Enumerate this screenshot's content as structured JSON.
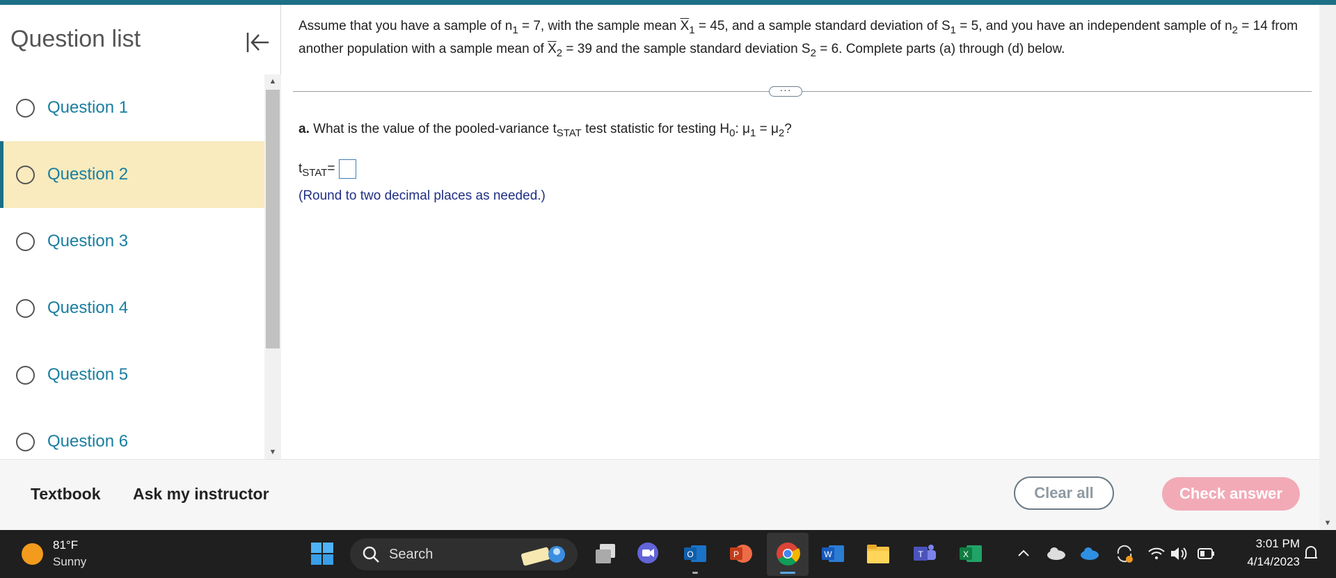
{
  "sidebar": {
    "title": "Question list",
    "items": [
      {
        "label": "Question 1"
      },
      {
        "label": "Question 2"
      },
      {
        "label": "Question 3"
      },
      {
        "label": "Question 4"
      },
      {
        "label": "Question 5"
      },
      {
        "label": "Question 6"
      }
    ],
    "active_index": 1
  },
  "problem": {
    "t1": "Assume that you have a sample of n",
    "s1": "1",
    "t2": " = 7, with the sample mean ",
    "xbar1": "X",
    "s2": "1",
    "t3": " = 45, and a sample standard deviation of S",
    "s3": "1",
    "t4": " = 5, and you have an independent sample of n",
    "s4": "2",
    "t5": " = 14 from another population with a sample mean of ",
    "xbar2": "X",
    "s5": "2",
    "t6": " = 39 and the sample standard deviation S",
    "s6": "2",
    "t7": " = 6. Complete parts (a) through (d) below."
  },
  "more_label": "···",
  "part_a": {
    "letter": "a.",
    "text1": " What is the value of the pooled-variance t",
    "sub1": "STAT",
    "text2": " test statistic for testing H",
    "sub2": "0",
    "text3": ": μ",
    "sub3": "1",
    "text4": " = μ",
    "sub4": "2",
    "text5": "?"
  },
  "answer": {
    "var": "t",
    "var_sub": "STAT",
    "eq": " =",
    "value": "",
    "hint": "(Round to two decimal places as needed.)"
  },
  "footer": {
    "textbook": "Textbook",
    "ask": "Ask my instructor",
    "clear": "Clear all",
    "check": "Check answer"
  },
  "taskbar": {
    "temp": "81°F",
    "condition": "Sunny",
    "search": "Search",
    "time": "3:01 PM",
    "date": "4/14/2023"
  },
  "colors": {
    "accent": "#1d6f86",
    "active_bg": "#f9ebbe",
    "link": "#1a7ea0",
    "check_btn": "#f2aab7"
  }
}
